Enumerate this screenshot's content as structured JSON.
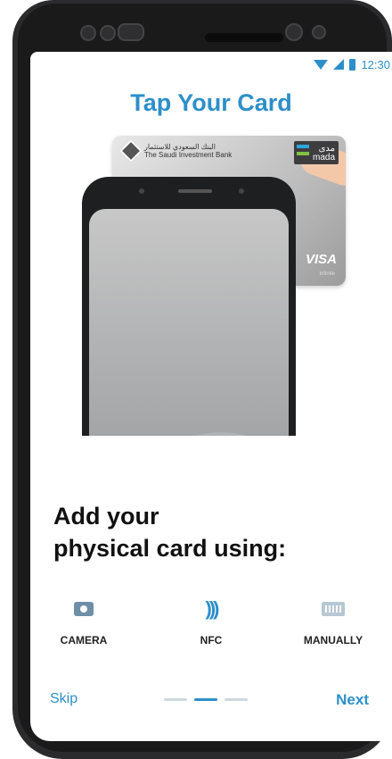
{
  "status": {
    "time": "12:30",
    "icons": [
      "wifi-icon",
      "signal-icon",
      "battery-icon"
    ]
  },
  "title": "Tap Your Card",
  "card": {
    "bank_name_line1": "البنك السعودي للاستثمار",
    "bank_name_line2": "The Saudi Investment Bank",
    "mada_line1": "مدى",
    "mada_line2": "mada",
    "network": "VISA",
    "network_sub": "Infinite"
  },
  "nfc_symbol": ")))",
  "headline": {
    "line1": "Add your",
    "line2": "physical card using:"
  },
  "options": [
    {
      "label": "CAMERA",
      "icon": "camera-icon"
    },
    {
      "label": "NFC",
      "icon": "nfc-icon",
      "symbol": ")))"
    },
    {
      "label": "MANUALLY",
      "icon": "keyboard-icon"
    }
  ],
  "footer": {
    "skip_label": "Skip",
    "next_label": "Next",
    "pages_total": 3,
    "page_active": 2
  },
  "colors": {
    "accent": "#2d8fc9",
    "frame": "#2b2b2d"
  }
}
